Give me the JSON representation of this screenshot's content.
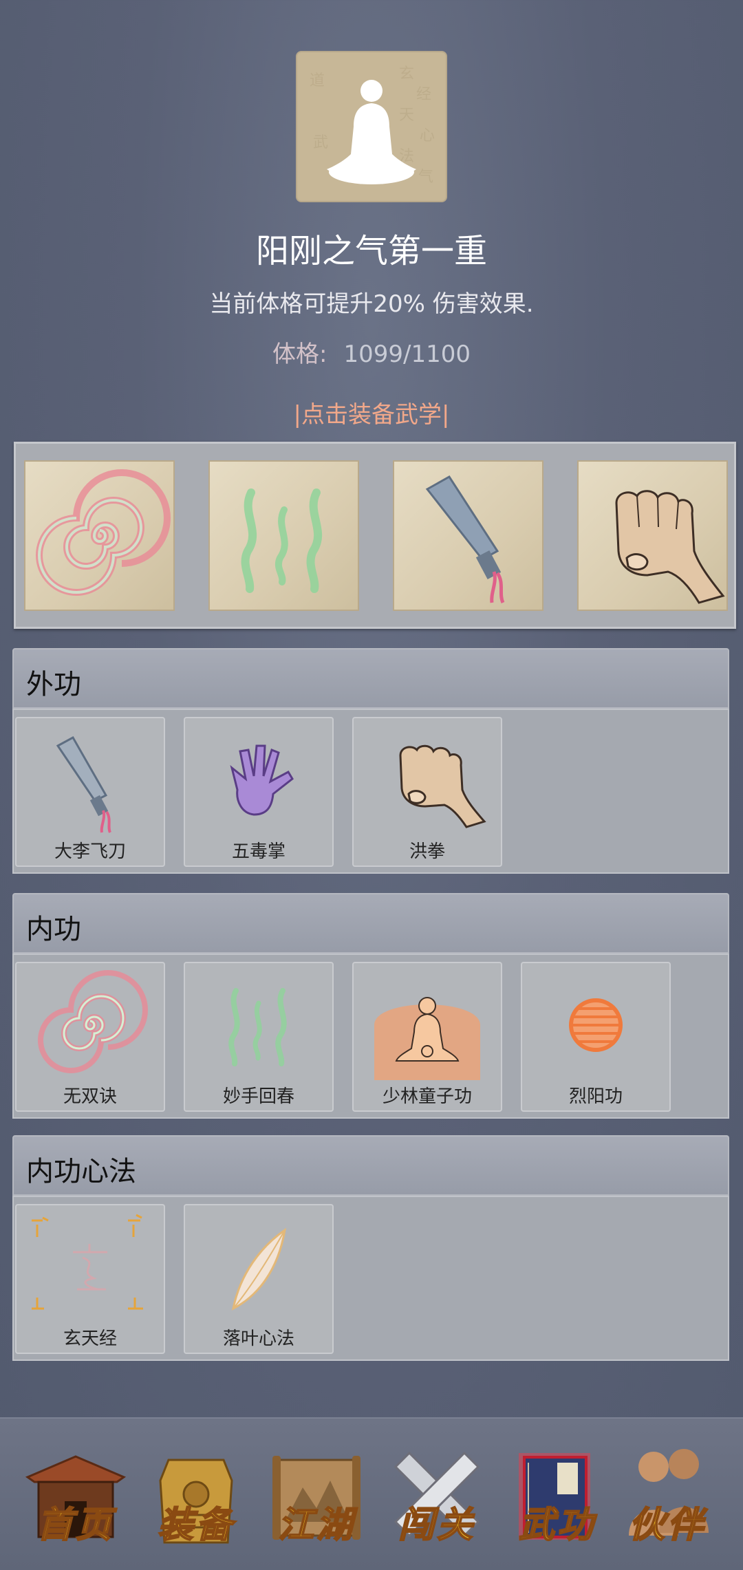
{
  "hero": {
    "title": "阳刚之气第一重",
    "description": "当前体格可提升20% 伤害效果.",
    "stat_label": "体格:",
    "stat_value": "1099/1100",
    "equip_link": "|点击装备武学|"
  },
  "equip_slots": [
    {
      "icon": "swirl-icon"
    },
    {
      "icon": "green-waves-icon"
    },
    {
      "icon": "flying-blade-icon"
    },
    {
      "icon": "fist-icon"
    }
  ],
  "sections": {
    "external": {
      "title": "外功",
      "skills": [
        {
          "name": "大李飞刀",
          "icon": "flying-blade-icon"
        },
        {
          "name": "五毒掌",
          "icon": "purple-palm-icon"
        },
        {
          "name": "洪拳",
          "icon": "fist-icon"
        }
      ]
    },
    "internal": {
      "title": "内功",
      "skills": [
        {
          "name": "无双诀",
          "icon": "swirl-icon"
        },
        {
          "name": "妙手回春",
          "icon": "green-waves-icon"
        },
        {
          "name": "少林童子功",
          "icon": "meditating-monk-icon"
        },
        {
          "name": "烈阳功",
          "icon": "orange-sphere-icon"
        }
      ]
    },
    "mind": {
      "title": "内功心法",
      "skills": [
        {
          "name": "玄天经",
          "icon": "xuan-glyph-icon"
        },
        {
          "name": "落叶心法",
          "icon": "leaf-icon"
        }
      ]
    }
  },
  "nav": [
    {
      "label": "首页",
      "icon": "house-icon"
    },
    {
      "label": "装备",
      "icon": "armor-icon"
    },
    {
      "label": "江湖",
      "icon": "scroll-map-icon"
    },
    {
      "label": "闯关",
      "icon": "crossed-swords-icon"
    },
    {
      "label": "武功",
      "icon": "book-icon"
    },
    {
      "label": "伙伴",
      "icon": "companions-icon"
    }
  ],
  "colors": {
    "background": "#5a6176",
    "accent_link": "#f2a88a",
    "nav_label": "#f2c024"
  }
}
